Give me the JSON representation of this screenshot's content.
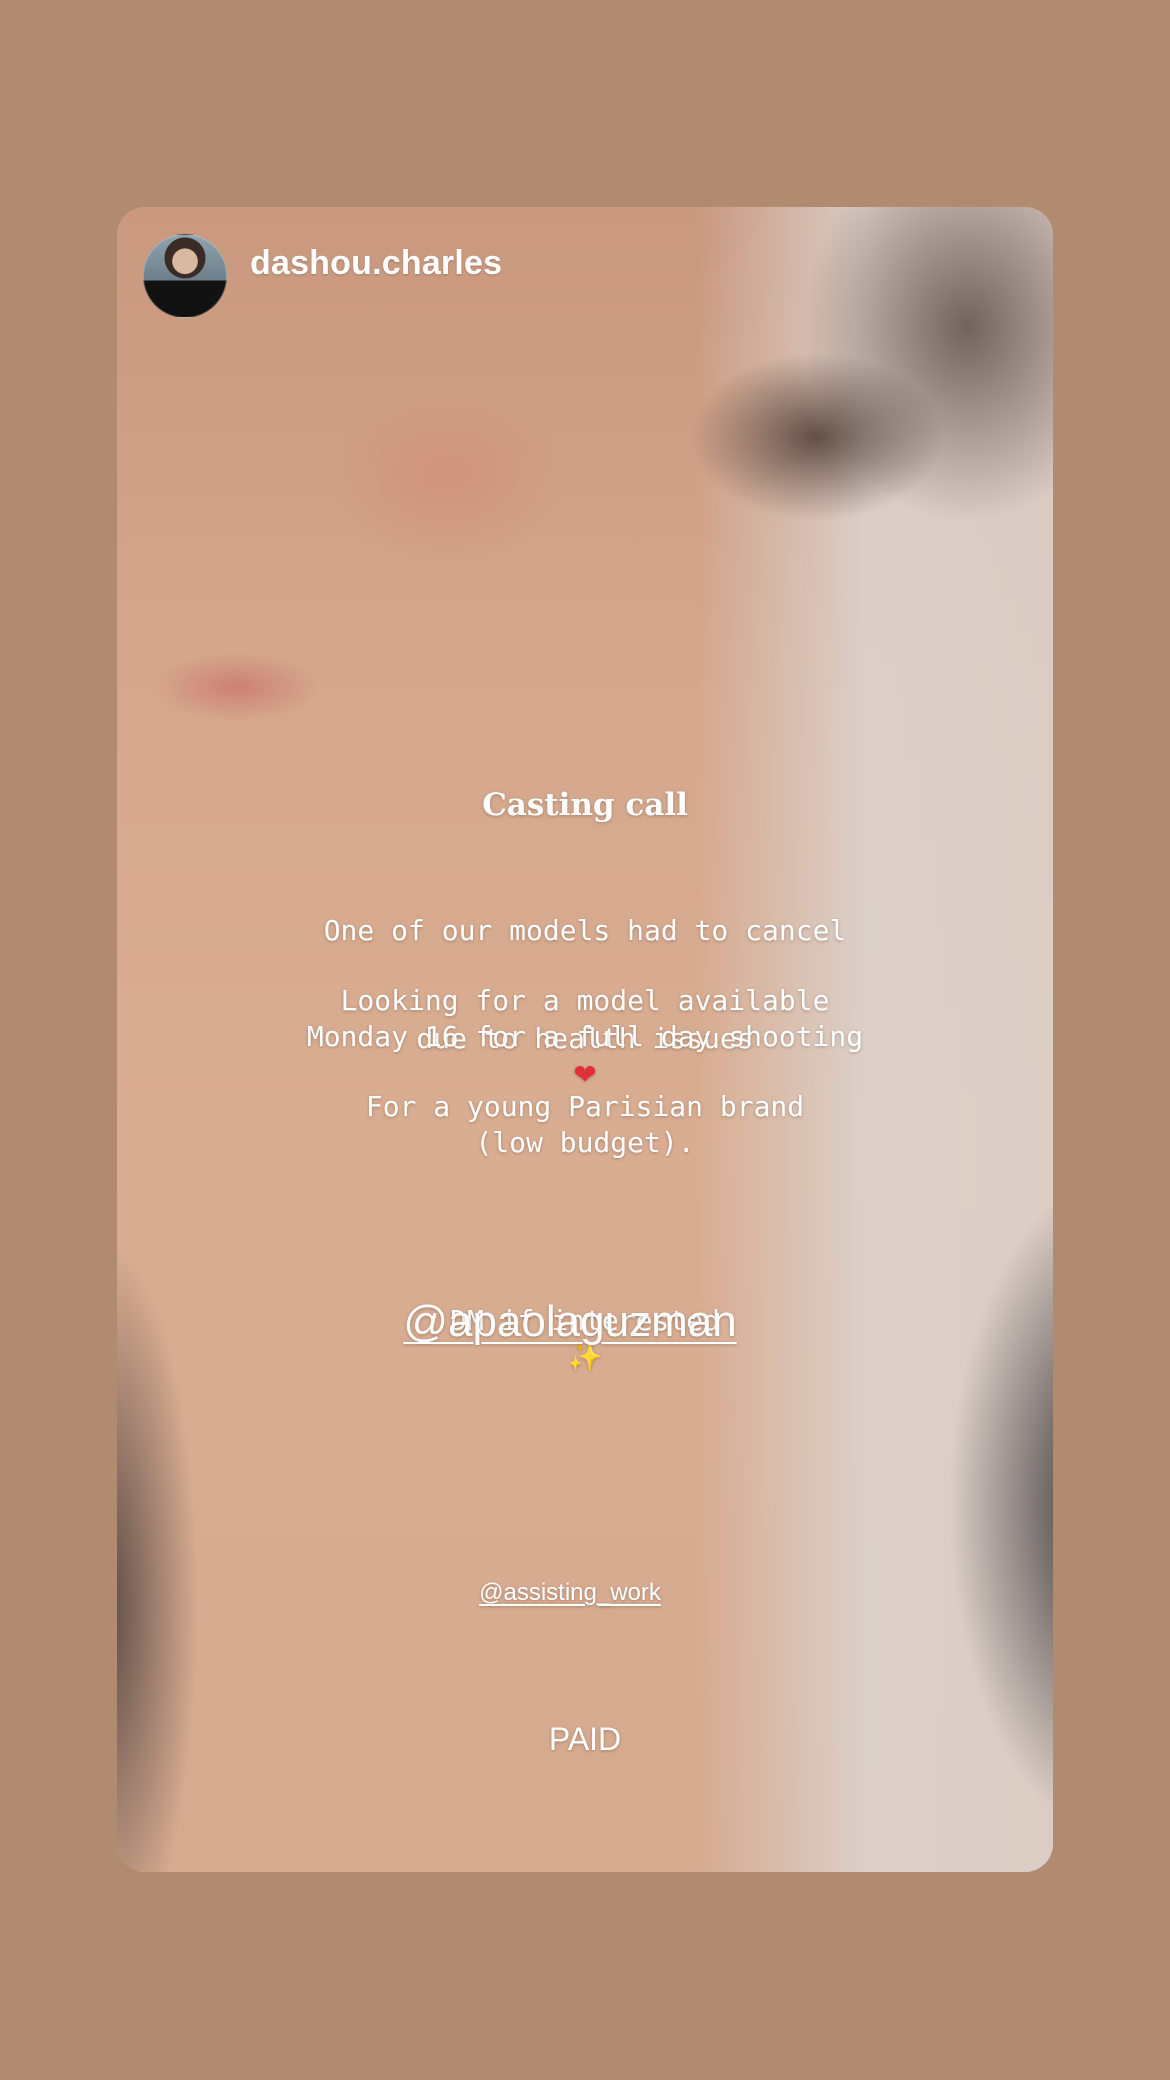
{
  "story": {
    "username": "dashou.charles",
    "title": "Casting call",
    "para1_line1": "One of our models had to cancel",
    "para1_line2": "due to health issues",
    "para1_emoji": "❤",
    "para2": "Looking for a model available\nMonday 16 for a full day shooting",
    "para3": "For a young Parisian brand\n(low budget).",
    "dm_text": "DM if interested",
    "dm_emoji": "✨",
    "mention_primary": "@apaolaguzman",
    "mention_secondary": "@assisting_work",
    "paid_label": "PAID"
  },
  "colors": {
    "page_background": "#b18b6f",
    "text": "#ffffff"
  },
  "icons": {
    "avatar": "profile-avatar",
    "heart": "mending-heart-emoji",
    "sparkle": "sparkles-emoji"
  }
}
